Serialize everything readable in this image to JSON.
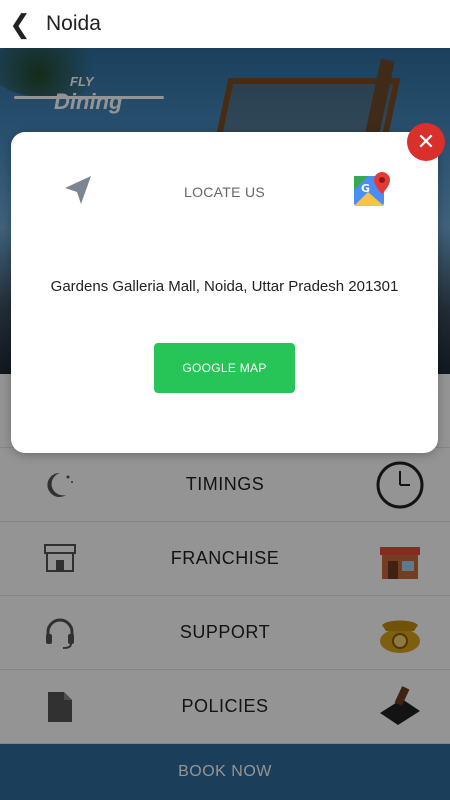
{
  "header": {
    "title": "Noida"
  },
  "hero": {
    "logo_small": "FLY",
    "logo_big": "Dining"
  },
  "dialog": {
    "locate_label": "LOCATE US",
    "address": "Gardens Galleria Mall, Noida, Uttar Pradesh 201301",
    "button_label": "GOOGLE MAP"
  },
  "menu": {
    "items": [
      {
        "label": "TIMINGS"
      },
      {
        "label": "FRANCHISE"
      },
      {
        "label": "SUPPORT"
      },
      {
        "label": "POLICIES"
      }
    ]
  },
  "footer": {
    "book_label": "BOOK NOW"
  },
  "colors": {
    "accent_green": "#27c457",
    "close_red": "#d9302c",
    "book_bar": "#2f6c9c"
  }
}
